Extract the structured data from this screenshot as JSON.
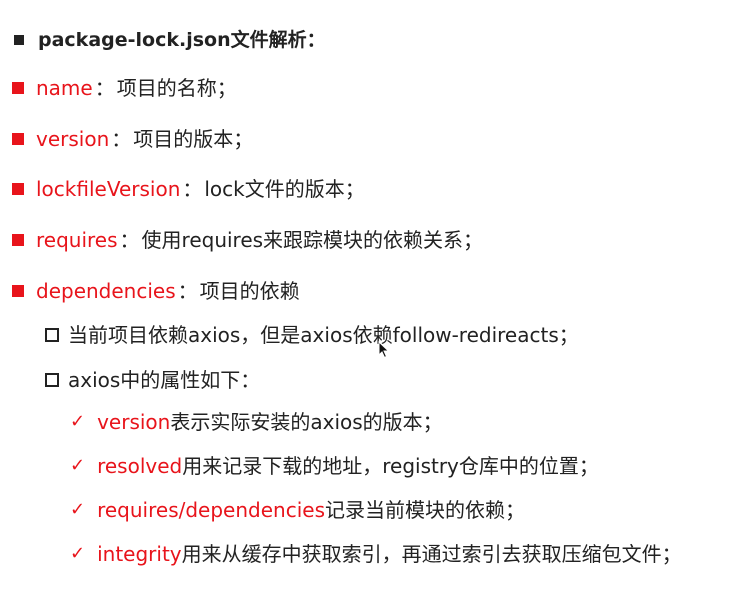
{
  "title": "package-lock.json文件解析：",
  "items": [
    {
      "key": "name",
      "sep": "：",
      "desc": "项目的名称；"
    },
    {
      "key": "version",
      "sep": "：",
      "desc": "项目的版本；"
    },
    {
      "key": "lockfileVersion",
      "sep": "：",
      "desc": "lock文件的版本；"
    },
    {
      "key": "requires",
      "sep": "：",
      "desc": "使用requires来跟踪模块的依赖关系；"
    },
    {
      "key": "dependencies",
      "sep": "：",
      "desc": "项目的依赖"
    }
  ],
  "sub_items": [
    "当前项目依赖axios，但是axios依赖follow-redireacts；",
    "axios中的属性如下："
  ],
  "check_items": [
    {
      "key": "version",
      "desc": "表示实际安装的axios的版本；"
    },
    {
      "key": "resolved",
      "desc": "用来记录下载的地址，registry仓库中的位置；"
    },
    {
      "key": "requires/dependencies",
      "desc": "记录当前模块的依赖；"
    },
    {
      "key": "integrity",
      "desc": "用来从缓存中获取索引，再通过索引去获取压缩包文件；"
    }
  ],
  "colors": {
    "accent": "#e8141b",
    "text": "#222222"
  },
  "icons": {
    "level1": "square-bullet-icon",
    "level2": "hollow-square-bullet-icon",
    "level3": "check-icon",
    "pointer": "mouse-cursor-icon"
  }
}
